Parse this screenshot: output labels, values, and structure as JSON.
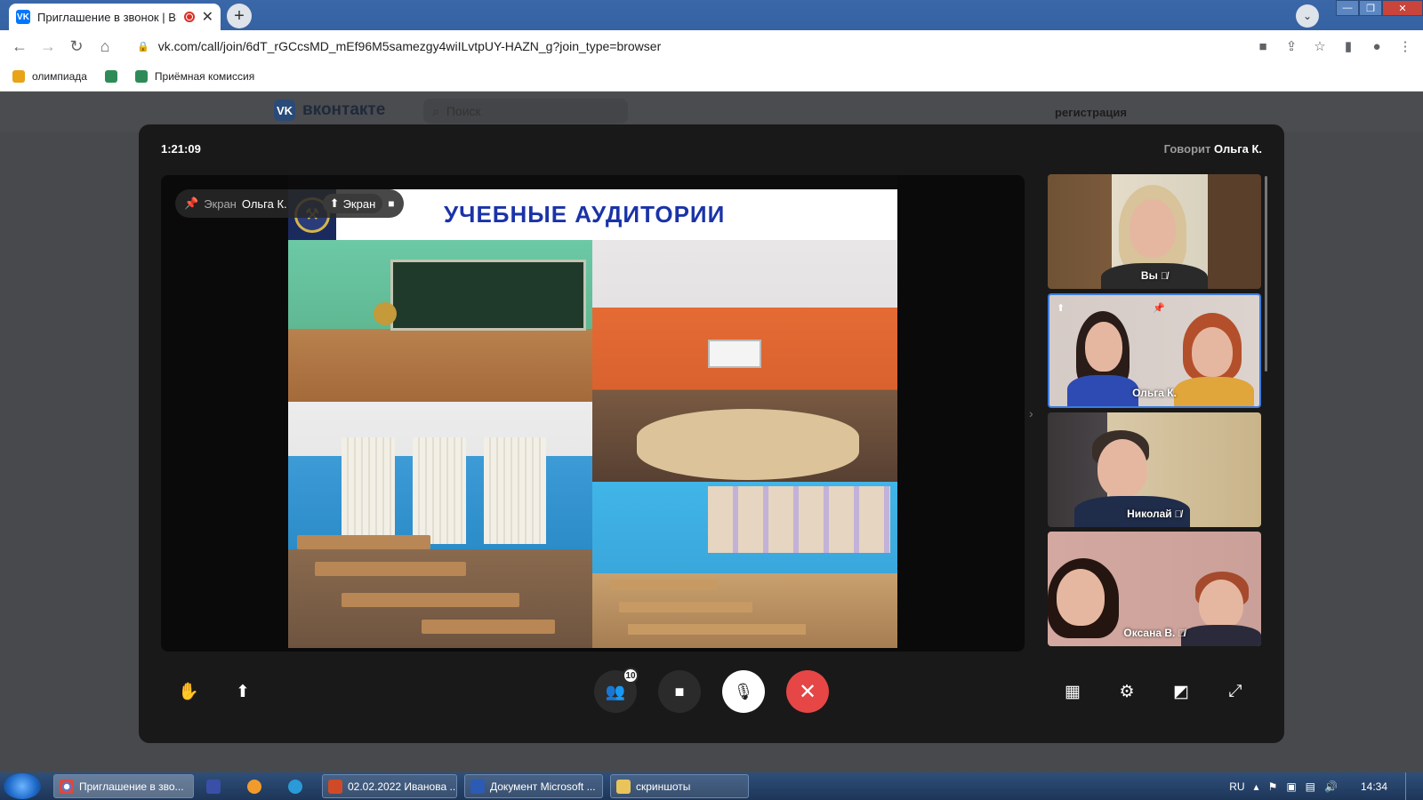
{
  "browser": {
    "tab_title": "Приглашение в звонок | ВК",
    "tab_favicon": "vk-icon",
    "new_tab": "+",
    "url": "vk.com/call/join/6dT_rGCcsMD_mEf96M5samezgy4wiILvtpUY-HAZN_g?join_type=browser",
    "bookmarks": [
      {
        "label": "олимпиада",
        "icon": "bookmark-icon"
      },
      {
        "label": "",
        "icon": "shield-icon"
      },
      {
        "label": "Приёмная комиссия",
        "icon": "shield-icon"
      }
    ]
  },
  "vk": {
    "logo_text": "вконтакте",
    "search_placeholder": "Поиск",
    "register": "регистрация"
  },
  "call": {
    "timer": "1:21:09",
    "speaking_prefix": "Говорит",
    "speaking_name": "Ольга К.",
    "screen_pill": {
      "label": "Экран",
      "owner": "Ольга К.",
      "screen_label": "Экран"
    },
    "slide": {
      "title": "УЧЕБНЫЕ АУДИТОРИИ"
    },
    "participants": [
      {
        "name": "Вы",
        "muted": true
      },
      {
        "name": "Ольга К.",
        "muted": false
      },
      {
        "name": "Николай",
        "muted": true
      },
      {
        "name": "Оксана В.",
        "muted": true
      }
    ],
    "participants_count": "10",
    "controls": {
      "left": [
        "raise-hand-icon",
        "share-screen-icon"
      ],
      "center": [
        "participants-icon",
        "camera-icon",
        "mic-off-icon",
        "end-call-icon"
      ],
      "right": [
        "grid-icon",
        "settings-icon",
        "layout-icon",
        "fullscreen-icon"
      ]
    },
    "colors": {
      "end_call": "#e64646",
      "background": "#191919",
      "slide_title": "#1a33a8"
    }
  },
  "taskbar": {
    "items": [
      {
        "label": "Приглашение в зво...",
        "active": true
      },
      {
        "label": "",
        "active": false
      },
      {
        "label": "",
        "active": false
      },
      {
        "label": "",
        "active": false
      },
      {
        "label": "02.02.2022 Иванова ...",
        "active": false
      },
      {
        "label": "Документ Microsoft ...",
        "active": false
      },
      {
        "label": "скриншоты",
        "active": false
      }
    ],
    "lang": "RU",
    "time": "14:34"
  }
}
